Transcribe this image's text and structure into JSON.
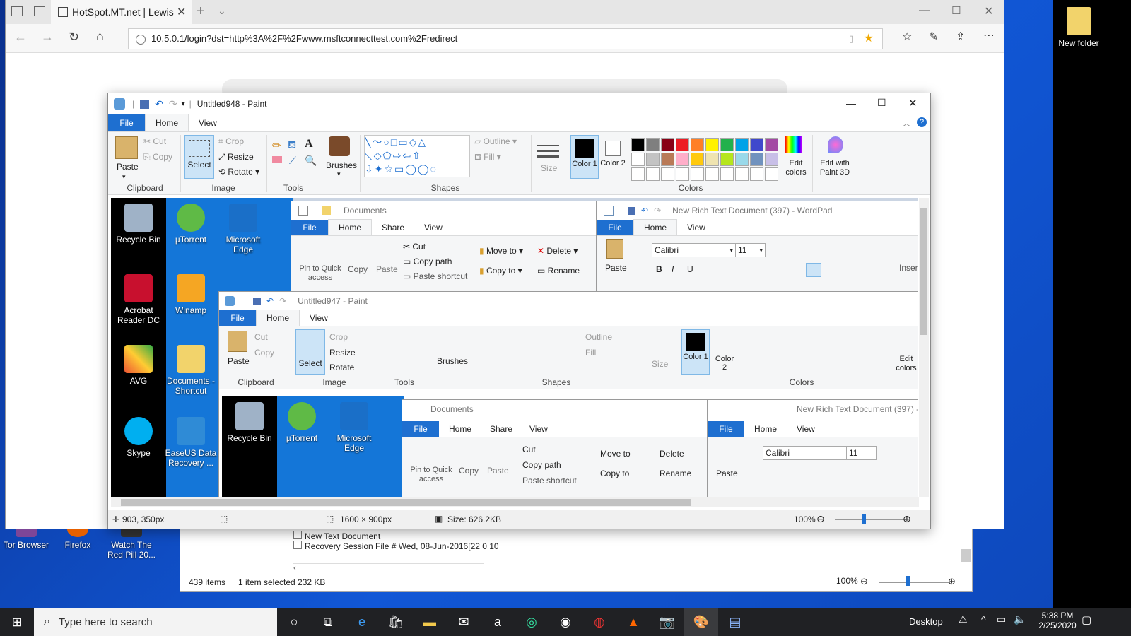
{
  "browser": {
    "tab_title": "HotSpot.MT.net | Lewis",
    "url": "10.5.0.1/login?dst=http%3A%2F%2Fwww.msftconnecttest.com%2Fredirect"
  },
  "desktop": {
    "icons_right": [
      {
        "label": "New folder"
      }
    ],
    "icons_left_bottom": [
      {
        "label": "Tor Browser"
      },
      {
        "label": "Firefox"
      },
      {
        "label": "Watch The Red Pill 20..."
      }
    ]
  },
  "explorer_bg": {
    "rows": [
      "New Text Document",
      "Recovery Session File # Wed, 08-Jun-2016[22 0 10"
    ],
    "items_count": "439 items",
    "selected": "1 item selected  232 KB",
    "zoom": "100%"
  },
  "paint": {
    "title": "Untitled948 - Paint",
    "tabs": [
      "File",
      "Home",
      "View"
    ],
    "clipboard": {
      "paste": "Paste",
      "cut": "Cut",
      "copy": "Copy",
      "label": "Clipboard"
    },
    "image": {
      "select": "Select",
      "crop": "Crop",
      "resize": "Resize",
      "rotate": "Rotate",
      "label": "Image"
    },
    "tools": {
      "label": "Tools"
    },
    "brushes": "Brushes",
    "shapes": {
      "outline": "Outline",
      "fill": "Fill",
      "label": "Shapes"
    },
    "size": "Size",
    "colors": {
      "color1": "Color 1",
      "color2": "Color 2",
      "edit": "Edit colors",
      "paint3d": "Edit with Paint 3D",
      "label": "Colors",
      "palette_row1": [
        "#000000",
        "#7f7f7f",
        "#880015",
        "#ed1c24",
        "#ff7f27",
        "#fff200",
        "#22b14c",
        "#00a2e8",
        "#3f48cc",
        "#a349a4"
      ],
      "palette_row2": [
        "#ffffff",
        "#c3c3c3",
        "#b97a57",
        "#ffaec9",
        "#ffc90e",
        "#efe4b0",
        "#b5e61d",
        "#99d9ea",
        "#7092be",
        "#c8bfe7"
      ]
    },
    "status": {
      "pos": "903, 350px",
      "dims": "1600 × 900px",
      "size": "Size: 626.2KB",
      "zoom": "100%"
    }
  },
  "capture": {
    "desktop_icons_col1": [
      "Recycle Bin",
      "Acrobat Reader DC",
      "AVG",
      "Skype"
    ],
    "desktop_icons_col2": [
      "µTorrent",
      "Winamp",
      "Documents - Shortcut",
      "EaseUS Data Recovery ..."
    ],
    "desktop_icons_col3": [
      "Microsoft Edge"
    ],
    "explorer": {
      "title": "Documents",
      "tabs": [
        "File",
        "Home",
        "Share",
        "View"
      ],
      "pin": "Pin to Quick access",
      "copy": "Copy",
      "paste": "Paste",
      "cut": "Cut",
      "copy_path": "Copy path",
      "paste_shortcut": "Paste shortcut",
      "move_to": "Move to",
      "copy_to": "Copy to",
      "delete": "Delete",
      "rename": "Rename"
    },
    "wordpad": {
      "title": "New Rich Text Document (397) - WordPad",
      "tabs": [
        "File",
        "Home",
        "View"
      ],
      "paste": "Paste",
      "font": "Calibri",
      "font_size": "11",
      "insert": "Inser"
    },
    "paint2": {
      "title": "Untitled947 - Paint"
    }
  },
  "taskbar": {
    "search_placeholder": "Type here to search",
    "desktop_label": "Desktop",
    "time": "5:38 PM",
    "date": "2/25/2020"
  }
}
